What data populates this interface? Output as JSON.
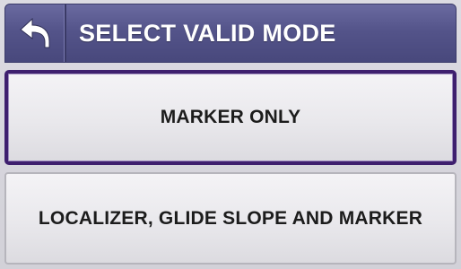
{
  "header": {
    "back_icon": "back-arrow-icon",
    "title": "SELECT VALID MODE",
    "accent_color": "#54548a"
  },
  "options": [
    {
      "label": "MARKER ONLY",
      "selected": true
    },
    {
      "label": "LOCALIZER, GLIDE SLOPE AND MARKER",
      "selected": false
    }
  ],
  "colors": {
    "selected_border": "#3e1f6e",
    "background": "#d9d8df"
  }
}
